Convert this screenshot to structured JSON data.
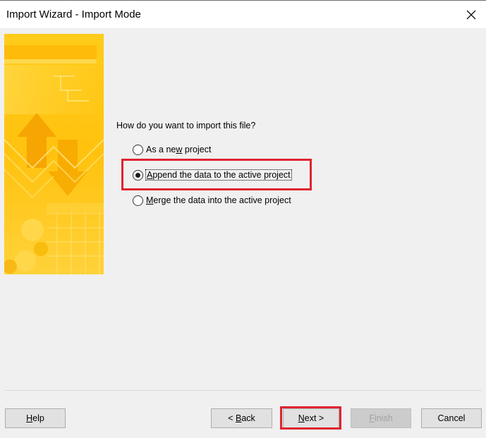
{
  "window": {
    "title": "Import Wizard - Import Mode"
  },
  "main": {
    "prompt": "How do you want to import this file?",
    "options": [
      {
        "pre": "As a ne",
        "accel": "w",
        "post": " project",
        "checked": false
      },
      {
        "pre": "",
        "accel": "A",
        "post": "ppend the data to the active project",
        "checked": true
      },
      {
        "pre": "",
        "accel": "M",
        "post": "erge the data into the active project",
        "checked": false
      }
    ]
  },
  "buttons": {
    "help": {
      "accel": "H",
      "rest": "elp"
    },
    "back": {
      "pre": "< ",
      "accel": "B",
      "rest": "ack"
    },
    "next": {
      "accel": "N",
      "rest": "ext >"
    },
    "finish": {
      "accel": "F",
      "rest": "inish"
    },
    "cancel": "Cancel"
  },
  "colors": {
    "highlight": "#e0242f",
    "banner_base": "#ffc20e",
    "banner_light": "#ffe36b"
  },
  "icons": [
    "close-icon",
    "radio-icon"
  ]
}
